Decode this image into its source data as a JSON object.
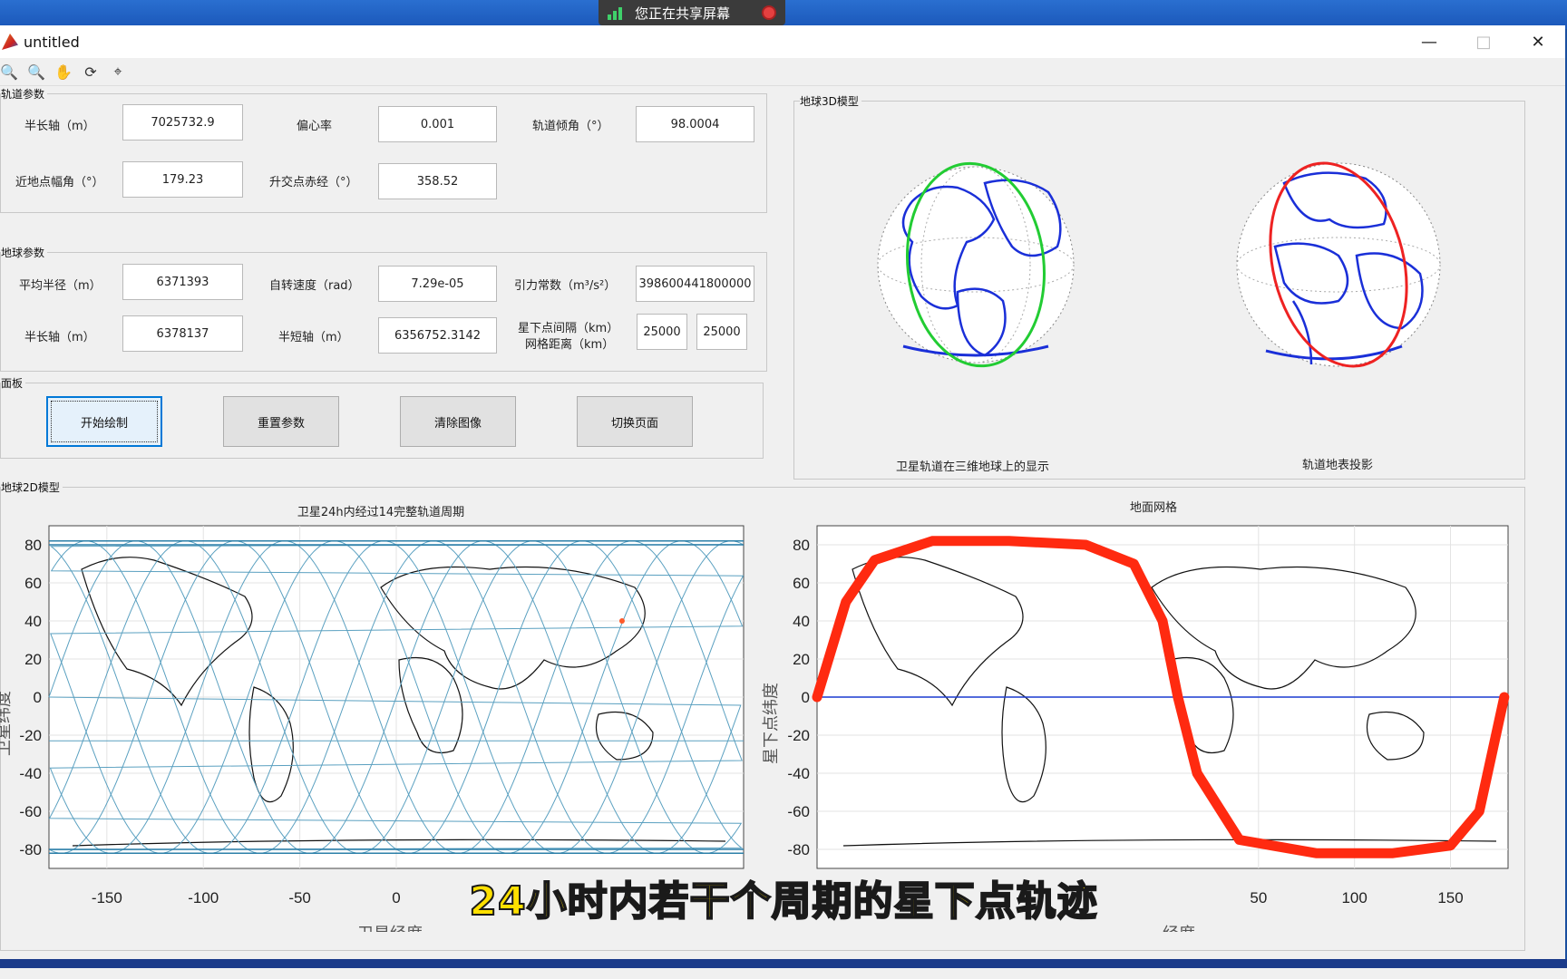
{
  "share_bar": {
    "text": "您正在共享屏幕"
  },
  "window": {
    "title": "untitled"
  },
  "winbtns": {
    "min": "—",
    "max": "□",
    "close": "✕"
  },
  "orbit_panel": {
    "title": "轨道参数",
    "fields": [
      {
        "label": "半长轴（m）",
        "value": "7025732.9"
      },
      {
        "label": "偏心率",
        "value": "0.001"
      },
      {
        "label": "轨道倾角（°）",
        "value": "98.0004"
      },
      {
        "label": "近地点幅角（°）",
        "value": "179.23"
      },
      {
        "label": "升交点赤经（°）",
        "value": "358.52"
      }
    ]
  },
  "earth_panel": {
    "title": "地球参数",
    "fields": [
      {
        "label": "平均半径（m）",
        "value": "6371393"
      },
      {
        "label": "自转速度（rad）",
        "value": "7.29e-05"
      },
      {
        "label": "引力常数（m³/s²）",
        "value": "398600441800000"
      },
      {
        "label": "半长轴（m）",
        "value": "6378137"
      },
      {
        "label": "半短轴（m）",
        "value": "6356752.3142"
      },
      {
        "label": "星下点间隔（km）",
        "value": "25000"
      },
      {
        "label": "网格距离（km）",
        "value": "25000"
      }
    ]
  },
  "control_panel": {
    "title": "面板",
    "buttons": [
      "开始绘制",
      "重置参数",
      "清除图像",
      "切换页面"
    ]
  },
  "model3d_panel": {
    "title": "地球3D模型",
    "captions": [
      "卫星轨道在三维地球上的显示",
      "轨道地表投影"
    ]
  },
  "model2d_panel": {
    "title": "地球2D模型"
  },
  "chart_data": [
    {
      "type": "line",
      "title": "卫星24h内经过14完整轨道周期",
      "xlabel": "卫星经度",
      "ylabel": "卫星纬度",
      "xticks": [
        -150,
        -100,
        -50,
        0
      ],
      "yticks": [
        80,
        60,
        40,
        20,
        0,
        -20,
        -40,
        -60,
        -80
      ],
      "xlim": [
        -180,
        180
      ],
      "ylim": [
        -90,
        90
      ],
      "series": [
        {
          "color": "#5aa0c0",
          "description_values": {
            "orbits": 14,
            "max_lat": 82,
            "min_lat": -82
          }
        }
      ],
      "marker": {
        "x": 117,
        "y": 40,
        "color": "#ff5a2a"
      }
    },
    {
      "type": "line",
      "title": "地面网格",
      "xlabel": "经度",
      "ylabel": "星下点纬度",
      "xticks": [
        50,
        100,
        150
      ],
      "yticks": [
        80,
        60,
        40,
        20,
        0,
        -20,
        -40,
        -60,
        -80
      ],
      "xlim": [
        -180,
        180
      ],
      "ylim": [
        -90,
        90
      ],
      "series": [
        {
          "color": "#ff2a10",
          "x": [
            -180,
            -165,
            -150,
            -120,
            -80,
            -40,
            -15,
            0,
            8,
            18,
            40,
            80,
            120,
            150,
            165,
            178
          ],
          "y": [
            0,
            50,
            72,
            82,
            82,
            80,
            70,
            40,
            0,
            -40,
            -75,
            -82,
            -82,
            -78,
            -60,
            0
          ]
        },
        {
          "color": "#1a3ad0",
          "x": [
            -180,
            180
          ],
          "y": [
            0,
            0
          ]
        }
      ]
    }
  ],
  "subtitle": "24小时内若干个周期的星下点轨迹",
  "colors": {
    "accent": "#0078d7",
    "orbit_green": "#22cc33",
    "orbit_red": "#ee2222",
    "coast": "#1a2fd8"
  }
}
